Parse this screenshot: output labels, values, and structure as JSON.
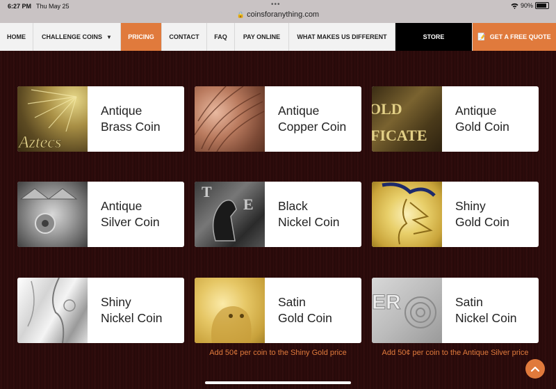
{
  "status": {
    "time": "6:27 PM",
    "date": "Thu May 25",
    "url": "coinsforanything.com",
    "battery": "90%"
  },
  "nav": {
    "items": [
      "HOME",
      "CHALLENGE COINS",
      "PRICING",
      "CONTACT",
      "FAQ",
      "PAY ONLINE",
      "WHAT MAKES US DIFFERENT",
      "STORE",
      "GET A FREE QUOTE"
    ],
    "active": "PRICING"
  },
  "cards": [
    {
      "line1": "Antique",
      "line2": "Brass Coin",
      "image_icon": "antique-brass-coin-image"
    },
    {
      "line1": "Antique",
      "line2": "Copper Coin",
      "image_icon": "antique-copper-coin-image"
    },
    {
      "line1": "Antique",
      "line2": "Gold Coin",
      "image_icon": "antique-gold-coin-image"
    },
    {
      "line1": "Antique",
      "line2": "Silver Coin",
      "image_icon": "antique-silver-coin-image"
    },
    {
      "line1": "Black",
      "line2": "Nickel Coin",
      "image_icon": "black-nickel-coin-image"
    },
    {
      "line1": "Shiny",
      "line2": "Gold Coin",
      "image_icon": "shiny-gold-coin-image"
    },
    {
      "line1": "Shiny",
      "line2": "Nickel Coin",
      "image_icon": "shiny-nickel-coin-image"
    },
    {
      "line1": "Satin",
      "line2": "Gold Coin",
      "image_icon": "satin-gold-coin-image"
    },
    {
      "line1": "Satin",
      "line2": "Nickel Coin",
      "image_icon": "satin-nickel-coin-image"
    }
  ],
  "notes": {
    "satin_gold": "Add 50¢ per coin to the Shiny Gold price",
    "satin_nickel": "Add 50¢ per coin to the Antique Silver price"
  },
  "colors": {
    "accent": "#e07a3c",
    "background": "#2a0b0b"
  }
}
